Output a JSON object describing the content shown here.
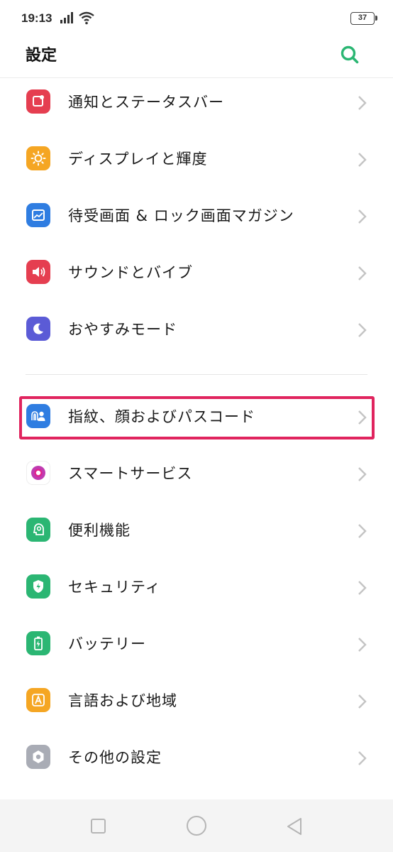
{
  "status_bar": {
    "time": "19:13",
    "battery": "37"
  },
  "header": {
    "title": "設定"
  },
  "colors": {
    "accent": "#2bb673",
    "highlight": "#e0245e",
    "notifications": "#e53e50",
    "display": "#f5a623",
    "wallpaper": "#2f7de1",
    "sound": "#e53e50",
    "dnd": "#5b5bd6",
    "fingerprint": "#2f7de1",
    "smart": "#c03ab0",
    "convenience": "#2bb673",
    "security": "#2bb673",
    "battery": "#2bb673",
    "language": "#f5a623",
    "other": "#a9acb5"
  },
  "settings": {
    "items": [
      {
        "label": "通知とステータスバー",
        "icon": "notification-icon"
      },
      {
        "label": "ディスプレイと輝度",
        "icon": "brightness-icon"
      },
      {
        "label": "待受画面 & ロック画面マガジン",
        "icon": "wallpaper-icon"
      },
      {
        "label": "サウンドとバイブ",
        "icon": "sound-icon"
      },
      {
        "label": "おやすみモード",
        "icon": "moon-icon"
      },
      {
        "label": "指紋、顔およびパスコード",
        "icon": "fingerprint-face-icon"
      },
      {
        "label": "スマートサービス",
        "icon": "smart-service-icon"
      },
      {
        "label": "便利機能",
        "icon": "convenience-icon"
      },
      {
        "label": "セキュリティ",
        "icon": "shield-icon"
      },
      {
        "label": "バッテリー",
        "icon": "battery-icon"
      },
      {
        "label": "言語および地域",
        "icon": "language-icon"
      },
      {
        "label": "その他の設定",
        "icon": "more-settings-icon"
      }
    ]
  }
}
